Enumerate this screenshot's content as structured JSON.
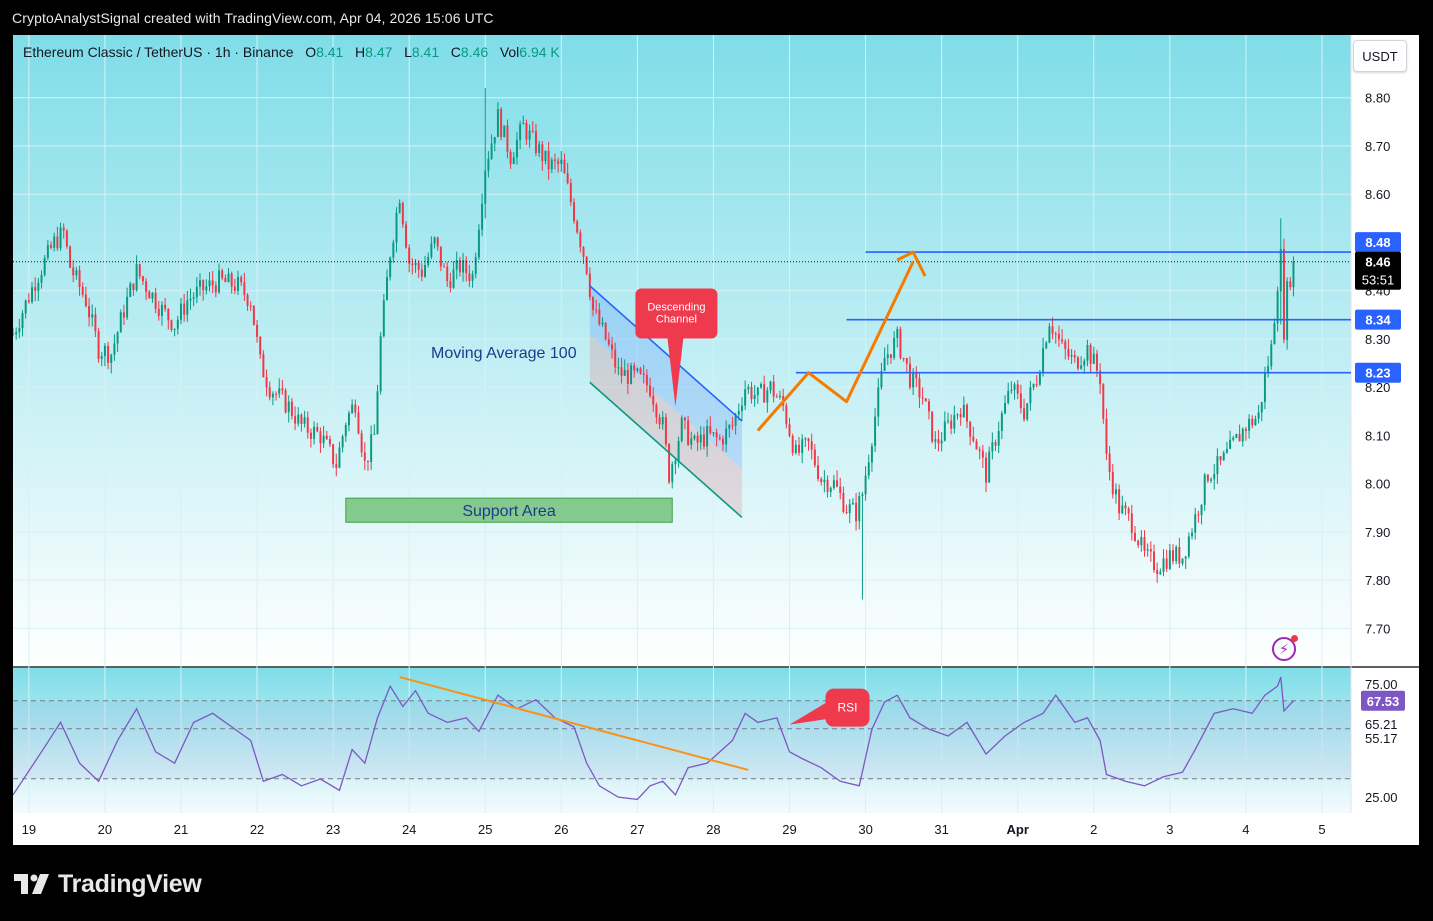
{
  "header": {
    "attribution": "CryptoAnalystSignal created with TradingView.com, Apr 04, 2026 15:06 UTC"
  },
  "legend": {
    "symbol": "Ethereum Classic / TetherUS · 1h · Binance",
    "o_label": "O",
    "o_value": "8.41",
    "h_label": "H",
    "h_value": "8.47",
    "l_label": "L",
    "l_value": "8.41",
    "c_label": "C",
    "c_value": "8.46",
    "vol_label": "Vol",
    "vol_value": "6.94 K"
  },
  "currency_button": "USDT",
  "footer": {
    "brand": "TradingView"
  },
  "colors": {
    "up": "#089981",
    "down": "#f23645",
    "level": "#2962ff",
    "arrow": "#f57c00",
    "rsi": "#7e57c2",
    "trendline": "#f7931a",
    "support": "#66bb6a",
    "callout": "#ef3a4e",
    "bg_top": "#7fdde8"
  },
  "chart_data": [
    {
      "type": "candlestick",
      "title": "",
      "ylim": [
        7.62,
        8.93
      ],
      "y_ticks": [
        "8.80",
        "8.70",
        "8.60",
        "8.40",
        "8.30",
        "8.20",
        "8.10",
        "8.00",
        "7.90",
        "7.80",
        "7.70"
      ],
      "x_ticks": [
        "19",
        "20",
        "21",
        "22",
        "23",
        "24",
        "25",
        "26",
        "27",
        "28",
        "29",
        "30",
        "31",
        "Apr",
        "2",
        "3",
        "4",
        "5"
      ],
      "x_tick_dates": [
        "Mar 19",
        "Mar 20",
        "Mar 21",
        "Mar 22",
        "Mar 23",
        "Mar 24",
        "Mar 25",
        "Mar 26",
        "Mar 27",
        "Mar 28",
        "Mar 29",
        "Mar 30",
        "Mar 31",
        "Apr 1",
        "Apr 2",
        "Apr 3",
        "Apr 4",
        "Apr 5"
      ],
      "x_range": [
        "Mar 18 19:00",
        "Apr 5 06:00"
      ],
      "close_path": [
        [
          "Mar 18 19:00",
          8.31
        ],
        [
          "Mar 19 02:00",
          8.42
        ],
        [
          "Mar 19 08:00",
          8.5
        ],
        [
          "Mar 19 11:00",
          8.52
        ],
        [
          "Mar 19 13:00",
          8.45
        ],
        [
          "Mar 19 18:00",
          8.38
        ],
        [
          "Mar 19 22:00",
          8.28
        ],
        [
          "Mar 20 02:00",
          8.27
        ],
        [
          "Mar 20 06:00",
          8.36
        ],
        [
          "Mar 20 10:00",
          8.44
        ],
        [
          "Mar 20 14:00",
          8.4
        ],
        [
          "Mar 20 18:00",
          8.36
        ],
        [
          "Mar 20 22:00",
          8.33
        ],
        [
          "Mar 21 02:00",
          8.38
        ],
        [
          "Mar 21 06:00",
          8.4
        ],
        [
          "Mar 21 12:00",
          8.42
        ],
        [
          "Mar 21 18:00",
          8.41
        ],
        [
          "Mar 21 22:00",
          8.38
        ],
        [
          "Mar 22 01:00",
          8.25
        ],
        [
          "Mar 22 04:00",
          8.2
        ],
        [
          "Mar 22 10:00",
          8.16
        ],
        [
          "Mar 22 14:00",
          8.12
        ],
        [
          "Mar 22 20:00",
          8.1
        ],
        [
          "Mar 23 01:00",
          8.04
        ],
        [
          "Mar 23 04:00",
          8.13
        ],
        [
          "Mar 23 07:00",
          8.17
        ],
        [
          "Mar 23 10:00",
          8.04
        ],
        [
          "Mar 23 13:00",
          8.1
        ],
        [
          "Mar 23 15:00",
          8.3
        ],
        [
          "Mar 23 18:00",
          8.48
        ],
        [
          "Mar 23 21:00",
          8.6
        ],
        [
          "Mar 24 00:00",
          8.46
        ],
        [
          "Mar 24 04:00",
          8.44
        ],
        [
          "Mar 24 08:00",
          8.5
        ],
        [
          "Mar 24 12:00",
          8.42
        ],
        [
          "Mar 24 16:00",
          8.45
        ],
        [
          "Mar 24 20:00",
          8.43
        ],
        [
          "Mar 25 00:00",
          8.66
        ],
        [
          "Mar 25 04:00",
          8.76
        ],
        [
          "Mar 25 08:00",
          8.68
        ],
        [
          "Mar 25 12:00",
          8.74
        ],
        [
          "Mar 25 16:00",
          8.7
        ],
        [
          "Mar 25 20:00",
          8.66
        ],
        [
          "Mar 26 00:00",
          8.66
        ],
        [
          "Mar 26 04:00",
          8.56
        ],
        [
          "Mar 26 08:00",
          8.45
        ],
        [
          "Mar 26 10:00",
          8.36
        ],
        [
          "Mar 26 14:00",
          8.3
        ],
        [
          "Mar 26 18:00",
          8.23
        ],
        [
          "Mar 27 00:00",
          8.22
        ],
        [
          "Mar 27 04:00",
          8.2
        ],
        [
          "Mar 27 08:00",
          8.12
        ],
        [
          "Mar 27 10:00",
          8.02
        ],
        [
          "Mar 27 14:00",
          8.12
        ],
        [
          "Mar 27 18:00",
          8.08
        ],
        [
          "Mar 27 22:00",
          8.1
        ],
        [
          "Mar 28 02:00",
          8.09
        ],
        [
          "Mar 28 06:00",
          8.12
        ],
        [
          "Mar 28 10:00",
          8.2
        ],
        [
          "Mar 28 14:00",
          8.18
        ],
        [
          "Mar 28 18:00",
          8.2
        ],
        [
          "Mar 28 22:00",
          8.16
        ],
        [
          "Mar 29 02:00",
          8.06
        ],
        [
          "Mar 29 06:00",
          8.08
        ],
        [
          "Mar 29 10:00",
          8.01
        ],
        [
          "Mar 29 14:00",
          8.0
        ],
        [
          "Mar 29 18:00",
          7.95
        ],
        [
          "Mar 29 21:00",
          7.94
        ],
        [
          "Mar 29 23:00",
          7.98
        ],
        [
          "Mar 30 02:00",
          8.1
        ],
        [
          "Mar 30 06:00",
          8.26
        ],
        [
          "Mar 30 10:00",
          8.3
        ],
        [
          "Mar 30 14:00",
          8.22
        ],
        [
          "Mar 30 18:00",
          8.18
        ],
        [
          "Mar 30 22:00",
          8.08
        ],
        [
          "Mar 31 02:00",
          8.12
        ],
        [
          "Mar 31 06:00",
          8.16
        ],
        [
          "Mar 31 10:00",
          8.1
        ],
        [
          "Mar 31 14:00",
          8.02
        ],
        [
          "Mar 31 18:00",
          8.12
        ],
        [
          "Mar 31 22:00",
          8.2
        ],
        [
          "Apr 1 02:00",
          8.15
        ],
        [
          "Apr 1 06:00",
          8.22
        ],
        [
          "Apr 1 10:00",
          8.34
        ],
        [
          "Apr 1 14:00",
          8.28
        ],
        [
          "Apr 1 18:00",
          8.25
        ],
        [
          "Apr 1 22:00",
          8.28
        ],
        [
          "Apr 2 02:00",
          8.22
        ],
        [
          "Apr 2 04:00",
          8.05
        ],
        [
          "Apr 2 08:00",
          7.95
        ],
        [
          "Apr 2 12:00",
          7.92
        ],
        [
          "Apr 2 16:00",
          7.85
        ],
        [
          "Apr 2 20:00",
          7.83
        ],
        [
          "Apr 3 00:00",
          7.85
        ],
        [
          "Apr 3 04:00",
          7.85
        ],
        [
          "Apr 3 08:00",
          7.93
        ],
        [
          "Apr 3 12:00",
          8.02
        ],
        [
          "Apr 3 16:00",
          8.04
        ],
        [
          "Apr 3 20:00",
          8.08
        ],
        [
          "Apr 4 00:00",
          8.12
        ],
        [
          "Apr 4 04:00",
          8.14
        ],
        [
          "Apr 4 06:00",
          8.22
        ],
        [
          "Apr 4 08:00",
          8.28
        ],
        [
          "Apr 4 10:00",
          8.42
        ],
        [
          "Apr 4 11:00",
          8.47
        ],
        [
          "Apr 4 12:00",
          8.32
        ],
        [
          "Apr 4 13:00",
          8.4
        ],
        [
          "Apr 4 15:00",
          8.46
        ]
      ],
      "events": [
        {
          "time": "Mar 25 00:00",
          "high": 8.82,
          "low": 8.55
        },
        {
          "time": "Mar 29 23:00",
          "high": 7.96,
          "low": 7.76
        },
        {
          "time": "Apr 4 11:00",
          "high": 8.55,
          "low": 8.33
        }
      ],
      "price_labels": [
        {
          "value": "8.48",
          "kind": "level"
        },
        {
          "value": "8.46",
          "kind": "last"
        },
        {
          "value": "53:51",
          "kind": "countdown"
        },
        {
          "value": "8.34",
          "kind": "level"
        },
        {
          "value": "8.23",
          "kind": "level"
        }
      ],
      "last_price": 8.46,
      "horizontal_levels": [
        {
          "value": 8.48,
          "from": "Mar 30 00:00"
        },
        {
          "value": 8.34,
          "from": "Mar 29 18:00"
        },
        {
          "value": 8.23,
          "from": "Mar 29 02:00"
        }
      ],
      "support_zone": {
        "label": "Support Area",
        "from": "Mar 23 04:00",
        "to": "Mar 27 11:00",
        "top": 7.97,
        "bottom": 7.92
      },
      "descending_channel": {
        "label": "Descending Channel",
        "upper": [
          [
            "Mar 26 09:00",
            8.41
          ],
          [
            "Mar 28 09:00",
            8.13
          ]
        ],
        "lower": [
          [
            "Mar 26 09:00",
            8.21
          ],
          [
            "Mar 28 09:00",
            7.93
          ]
        ],
        "callout_anchor": [
          "Mar 27 12:00",
          8.16
        ]
      },
      "moving_average_label": "Moving Average 100",
      "projection_path": [
        [
          "Mar 28 14:00",
          8.11
        ],
        [
          "Mar 29 06:00",
          8.23
        ],
        [
          "Mar 29 18:00",
          8.17
        ],
        [
          "Mar 30 15:00",
          8.46
        ]
      ],
      "projection_arrow_head": {
        "tip": [
          "Mar 30 15:00",
          8.48
        ]
      }
    },
    {
      "type": "line",
      "series": [
        {
          "name": "RSI"
        }
      ],
      "ylim": [
        18,
        82
      ],
      "y_ticks": [
        "75.00",
        "25.00"
      ],
      "value_labels": [
        {
          "value": "67.53",
          "kind": "current"
        },
        {
          "value": "65.21",
          "kind": "plain"
        },
        {
          "value": "55.17",
          "kind": "plain"
        }
      ],
      "bands": [
        67.53,
        55.17,
        33.1
      ],
      "path": [
        [
          "Mar 18 19:00",
          26
        ],
        [
          "Mar 19 04:00",
          45
        ],
        [
          "Mar 19 10:00",
          58
        ],
        [
          "Mar 19 16:00",
          40
        ],
        [
          "Mar 19 22:00",
          32
        ],
        [
          "Mar 20 04:00",
          50
        ],
        [
          "Mar 20 10:00",
          64
        ],
        [
          "Mar 20 16:00",
          45
        ],
        [
          "Mar 20 22:00",
          40
        ],
        [
          "Mar 21 04:00",
          58
        ],
        [
          "Mar 21 10:00",
          62
        ],
        [
          "Mar 21 16:00",
          56
        ],
        [
          "Mar 21 22:00",
          50
        ],
        [
          "Mar 22 02:00",
          32
        ],
        [
          "Mar 22 08:00",
          35
        ],
        [
          "Mar 22 14:00",
          30
        ],
        [
          "Mar 22 20:00",
          33
        ],
        [
          "Mar 23 02:00",
          28
        ],
        [
          "Mar 23 06:00",
          46
        ],
        [
          "Mar 23 10:00",
          40
        ],
        [
          "Mar 23 14:00",
          60
        ],
        [
          "Mar 23 18:00",
          74
        ],
        [
          "Mar 23 22:00",
          65
        ],
        [
          "Mar 24 02:00",
          72
        ],
        [
          "Mar 24 06:00",
          62
        ],
        [
          "Mar 24 12:00",
          58
        ],
        [
          "Mar 24 18:00",
          60
        ],
        [
          "Mar 24 22:00",
          54
        ],
        [
          "Mar 25 04:00",
          70
        ],
        [
          "Mar 25 10:00",
          64
        ],
        [
          "Mar 25 16:00",
          68
        ],
        [
          "Mar 25 22:00",
          60
        ],
        [
          "Mar 26 04:00",
          56
        ],
        [
          "Mar 26 08:00",
          40
        ],
        [
          "Mar 26 12:00",
          30
        ],
        [
          "Mar 26 18:00",
          25
        ],
        [
          "Mar 27 00:00",
          24
        ],
        [
          "Mar 27 04:00",
          30
        ],
        [
          "Mar 27 08:00",
          32
        ],
        [
          "Mar 27 12:00",
          26
        ],
        [
          "Mar 27 16:00",
          38
        ],
        [
          "Mar 27 22:00",
          40
        ],
        [
          "Mar 28 02:00",
          45
        ],
        [
          "Mar 28 06:00",
          50
        ],
        [
          "Mar 28 10:00",
          62
        ],
        [
          "Mar 28 14:00",
          58
        ],
        [
          "Mar 28 20:00",
          60
        ],
        [
          "Mar 29 00:00",
          45
        ],
        [
          "Mar 29 04:00",
          42
        ],
        [
          "Mar 29 10:00",
          38
        ],
        [
          "Mar 29 16:00",
          32
        ],
        [
          "Mar 29 22:00",
          30
        ],
        [
          "Mar 30 02:00",
          55
        ],
        [
          "Mar 30 06:00",
          67
        ],
        [
          "Mar 30 10:00",
          70
        ],
        [
          "Mar 30 14:00",
          60
        ],
        [
          "Mar 30 20:00",
          55
        ],
        [
          "Mar 31 02:00",
          52
        ],
        [
          "Mar 31 08:00",
          58
        ],
        [
          "Mar 31 14:00",
          44
        ],
        [
          "Mar 31 20:00",
          52
        ],
        [
          "Apr 1 02:00",
          58
        ],
        [
          "Apr 1 08:00",
          62
        ],
        [
          "Apr 1 12:00",
          70
        ],
        [
          "Apr 1 18:00",
          58
        ],
        [
          "Apr 1 22:00",
          60
        ],
        [
          "Apr 2 02:00",
          50
        ],
        [
          "Apr 2 04:00",
          35
        ],
        [
          "Apr 2 10:00",
          32
        ],
        [
          "Apr 2 16:00",
          30
        ],
        [
          "Apr 2 22:00",
          34
        ],
        [
          "Apr 3 04:00",
          36
        ],
        [
          "Apr 3 08:00",
          46
        ],
        [
          "Apr 3 14:00",
          62
        ],
        [
          "Apr 3 20:00",
          64
        ],
        [
          "Apr 4 02:00",
          62
        ],
        [
          "Apr 4 06:00",
          70
        ],
        [
          "Apr 4 10:00",
          74
        ],
        [
          "Apr 4 11:00",
          78
        ],
        [
          "Apr 4 12:00",
          63
        ],
        [
          "Apr 4 15:00",
          67.53
        ]
      ],
      "trendline": [
        [
          "Mar 23 21:00",
          78
        ],
        [
          "Mar 28 11:00",
          37
        ]
      ],
      "callout": {
        "label": "RSI",
        "anchor": [
          "Mar 29 00:00",
          57
        ]
      }
    }
  ]
}
